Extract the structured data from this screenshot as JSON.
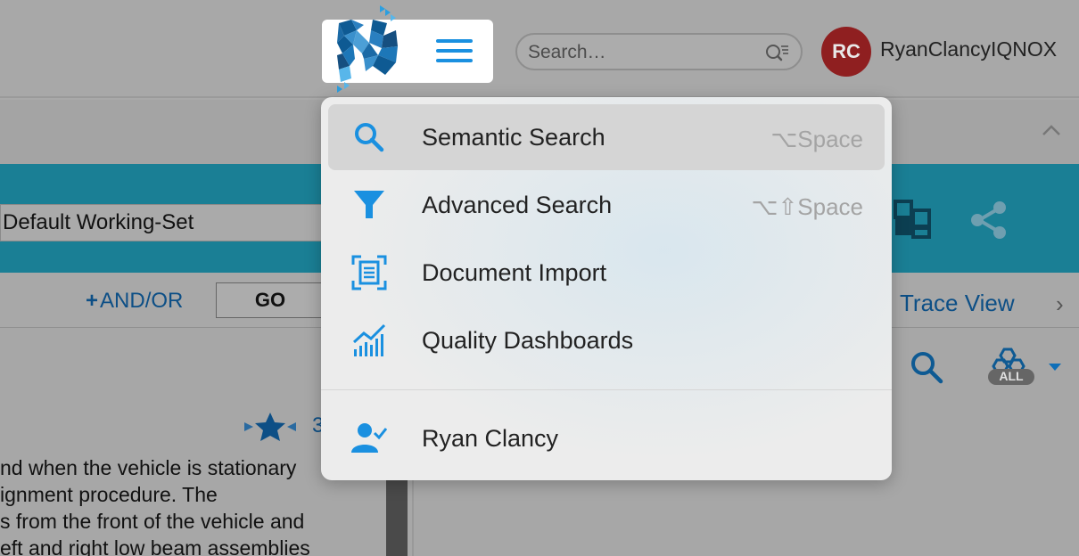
{
  "header": {
    "search_placeholder": "Search…",
    "avatar_initials": "RC",
    "username": "RyanClancyIQNOX"
  },
  "toolbar": {
    "working_set": "Default Working-Set",
    "andor_label": "AND/OR",
    "andor_plus": "+",
    "go_label": "GO",
    "trace_view_label": "Trace View",
    "trace_chevron": "›"
  },
  "content": {
    "rating_number": "3",
    "text_lines": [
      "nd when the vehicle is stationary",
      "ignment procedure. The",
      "s from the front of the vehicle and",
      "eft and right low beam assemblies"
    ],
    "all_badge": "ALL"
  },
  "menu": {
    "items": [
      {
        "label": "Semantic Search",
        "shortcut": "⌥Space",
        "icon": "search-icon"
      },
      {
        "label": "Advanced Search",
        "shortcut": "⌥⇧Space",
        "icon": "filter-icon"
      },
      {
        "label": "Document Import",
        "shortcut": "",
        "icon": "document-scan-icon"
      },
      {
        "label": "Quality Dashboards",
        "shortcut": "",
        "icon": "chart-icon"
      }
    ],
    "user_item": {
      "label": "Ryan Clancy",
      "icon": "user-check-icon"
    }
  },
  "colors": {
    "accent": "#1a90e0",
    "teal_bar": "#1a7f95",
    "avatar_bg": "#8f1f20",
    "link": "#0d4f86"
  }
}
